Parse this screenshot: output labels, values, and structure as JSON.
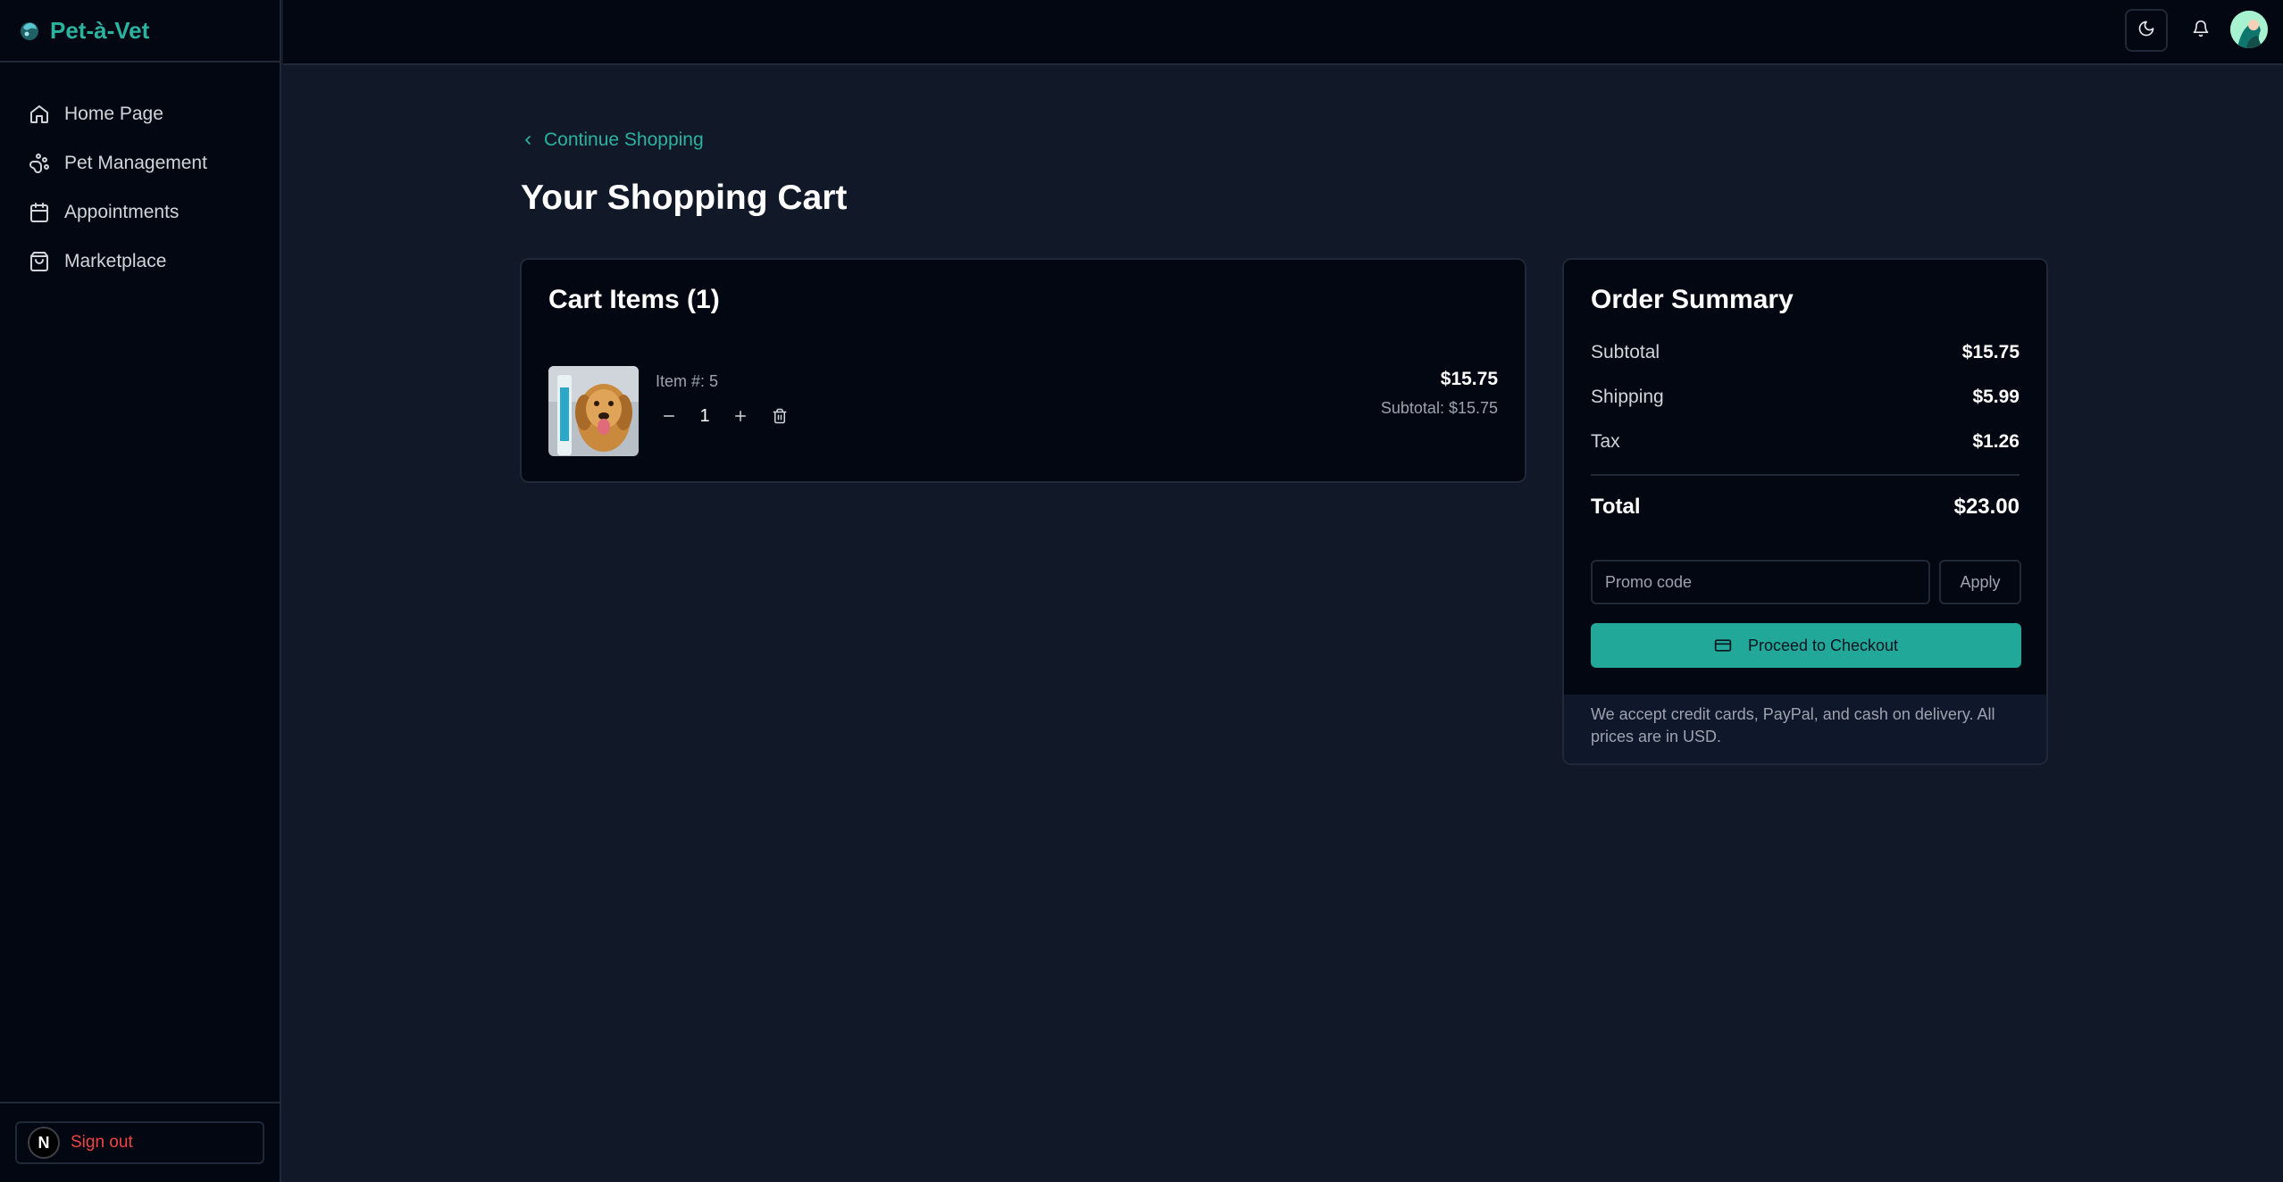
{
  "app": {
    "name": "Pet-à-Vet"
  },
  "sidebar": {
    "items": [
      {
        "label": "Home Page",
        "icon": "home-icon"
      },
      {
        "label": "Pet Management",
        "icon": "paw-icon"
      },
      {
        "label": "Appointments",
        "icon": "calendar-icon"
      },
      {
        "label": "Marketplace",
        "icon": "shopping-bag-icon"
      }
    ],
    "signout": {
      "avatar_letter": "N",
      "label": "Sign out"
    }
  },
  "topbar": {
    "theme_icon": "moon-icon",
    "notification_icon": "bell-icon"
  },
  "main": {
    "back_label": "Continue Shopping",
    "title": "Your Shopping Cart"
  },
  "cart": {
    "title": "Cart Items (1)",
    "items": [
      {
        "label": "Item #: 5",
        "quantity": "1",
        "price": "$15.75",
        "subtotal": "Subtotal: $15.75"
      }
    ]
  },
  "summary": {
    "title": "Order Summary",
    "subtotal_label": "Subtotal",
    "subtotal_value": "$15.75",
    "shipping_label": "Shipping",
    "shipping_value": "$5.99",
    "tax_label": "Tax",
    "tax_value": "$1.26",
    "total_label": "Total",
    "total_value": "$23.00",
    "promo_placeholder": "Promo code",
    "apply_label": "Apply",
    "checkout_label": "Proceed to Checkout",
    "note": "We accept credit cards, PayPal, and cash on delivery. All prices are in USD."
  },
  "colors": {
    "accent": "#2bb3a0",
    "button": "#22a898",
    "danger": "#ef4444",
    "background": "#111827",
    "panel": "#030712"
  }
}
